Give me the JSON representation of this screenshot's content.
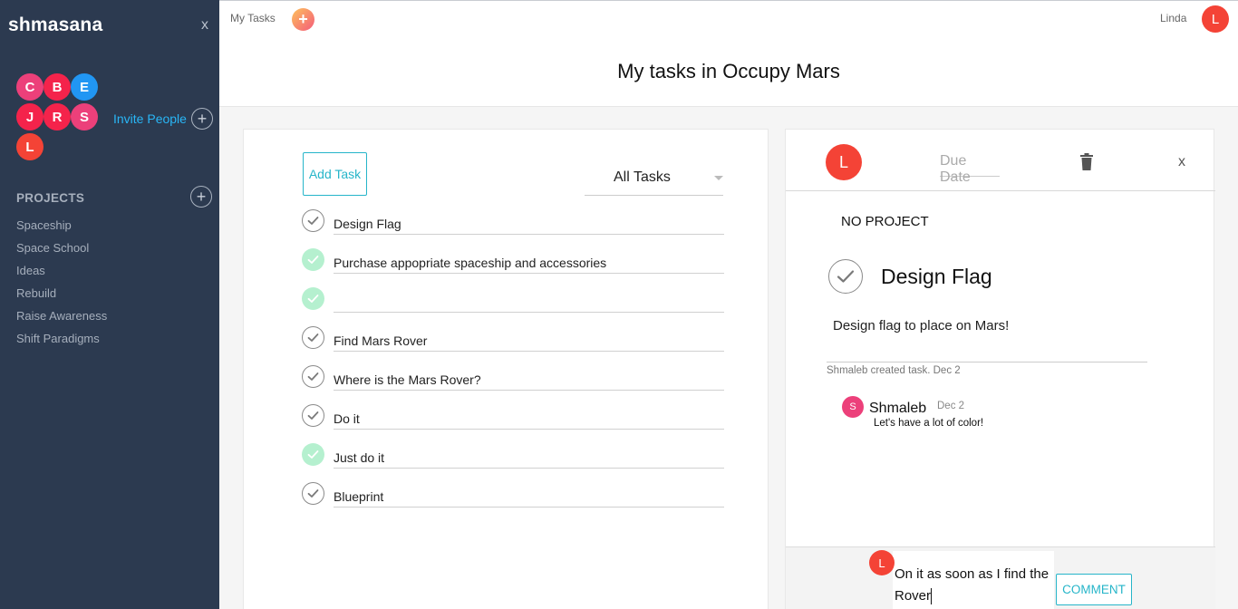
{
  "app": {
    "logo": "shmasana",
    "close_label": "x"
  },
  "sidebar": {
    "members": [
      {
        "initial": "C",
        "color": "#ec407a"
      },
      {
        "initial": "B",
        "color": "#f4234b"
      },
      {
        "initial": "E",
        "color": "#2196f3"
      },
      {
        "initial": "J",
        "color": "#f4234b"
      },
      {
        "initial": "R",
        "color": "#f4234b"
      },
      {
        "initial": "S",
        "color": "#ec407a"
      },
      {
        "initial": "L",
        "color": "#f44336"
      }
    ],
    "invite_label": "Invite People",
    "projects_title": "PROJECTS",
    "projects": [
      "Spaceship",
      "Space School",
      "Ideas",
      "Rebuild",
      "Raise Awareness",
      "Shift Paradigms"
    ]
  },
  "topbar": {
    "my_tasks_label": "My Tasks",
    "add_icon": "plus-icon",
    "user_name": "Linda",
    "user_initial": "L"
  },
  "page": {
    "title": "My tasks in Occupy Mars"
  },
  "task_list": {
    "add_task_label": "Add Task",
    "filter_value": "All Tasks",
    "tasks": [
      {
        "name": "Design Flag",
        "completed": false
      },
      {
        "name": "Purchase appopriate spaceship and accessories",
        "completed": true
      },
      {
        "name": "",
        "completed": true
      },
      {
        "name": "Find Mars Rover",
        "completed": false
      },
      {
        "name": "Where is the Mars Rover?",
        "completed": false
      },
      {
        "name": "Do it",
        "completed": false
      },
      {
        "name": "Just do it",
        "completed": true
      },
      {
        "name": "Blueprint",
        "completed": false
      }
    ]
  },
  "detail": {
    "assignee_initial": "L",
    "due_date_placeholder": "Due Date",
    "close_label": "x",
    "project_label": "NO PROJECT",
    "title": "Design Flag",
    "description": "Design flag to place on Mars!",
    "activity": "Shmaleb created task. Dec 2",
    "comments": [
      {
        "initial": "S",
        "author": "Shmaleb",
        "date": "Dec 2",
        "text": "Let's have a lot of color!"
      }
    ],
    "composer": {
      "initial": "L",
      "draft": "On it as soon as I find the Rover",
      "button_label": "COMMENT"
    }
  }
}
